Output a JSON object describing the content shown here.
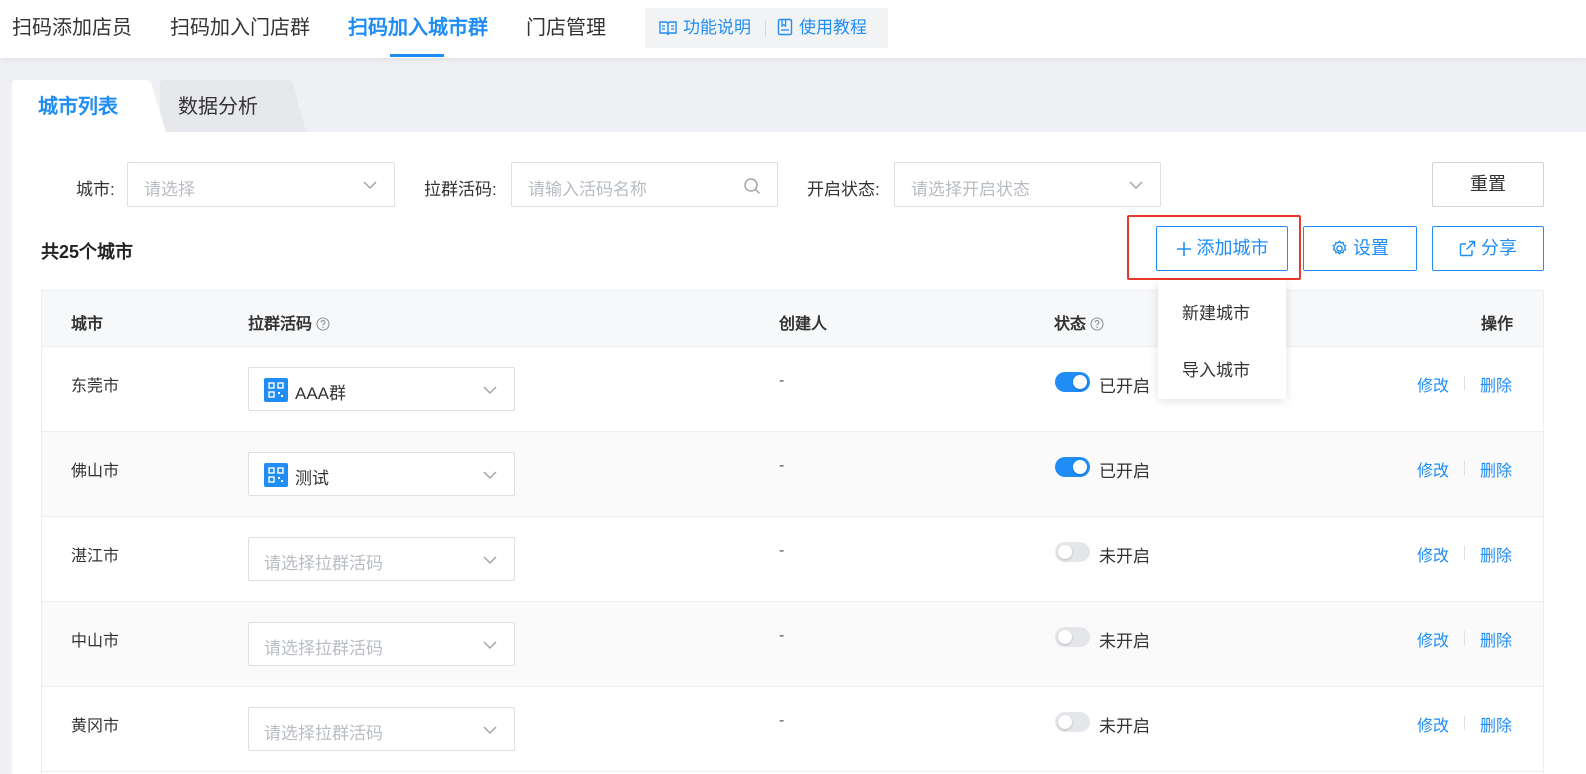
{
  "topnav": {
    "tabs": [
      {
        "label": "扫码添加店员"
      },
      {
        "label": "扫码加入门店群"
      },
      {
        "label": "扫码加入城市群"
      },
      {
        "label": "门店管理"
      }
    ],
    "help": {
      "feature_label": "功能说明",
      "tutorial_label": "使用教程"
    }
  },
  "subtabs": {
    "city_list": "城市列表",
    "data_analysis": "数据分析"
  },
  "filters": {
    "city_label": "城市:",
    "city_placeholder": "请选择",
    "code_label": "拉群活码:",
    "code_placeholder": "请输入活码名称",
    "status_label": "开启状态:",
    "status_placeholder": "请选择开启状态",
    "reset_label": "重置"
  },
  "toolbar": {
    "count_text": "共25个城市",
    "add_city_label": "添加城市",
    "settings_label": "设置",
    "share_label": "分享"
  },
  "dropdown": {
    "items": [
      "新建城市",
      "导入城市"
    ]
  },
  "table": {
    "headers": {
      "city": "城市",
      "code": "拉群活码",
      "creator": "创建人",
      "status": "状态",
      "action": "操作"
    },
    "code_placeholder": "请选择拉群活码",
    "edit_label": "修改",
    "delete_label": "删除",
    "rows": [
      {
        "city": "东莞市",
        "code": "AAA群",
        "creator": "-",
        "status_on": true,
        "status": "已开启"
      },
      {
        "city": "佛山市",
        "code": "测试",
        "creator": "-",
        "status_on": true,
        "status": "已开启"
      },
      {
        "city": "湛江市",
        "code": "",
        "creator": "-",
        "status_on": false,
        "status": "未开启"
      },
      {
        "city": "中山市",
        "code": "",
        "creator": "-",
        "status_on": false,
        "status": "未开启"
      },
      {
        "city": "黄冈市",
        "code": "",
        "creator": "-",
        "status_on": false,
        "status": "未开启"
      }
    ]
  },
  "colors": {
    "accent": "#1f8df5",
    "highlight": "#e8392c"
  }
}
